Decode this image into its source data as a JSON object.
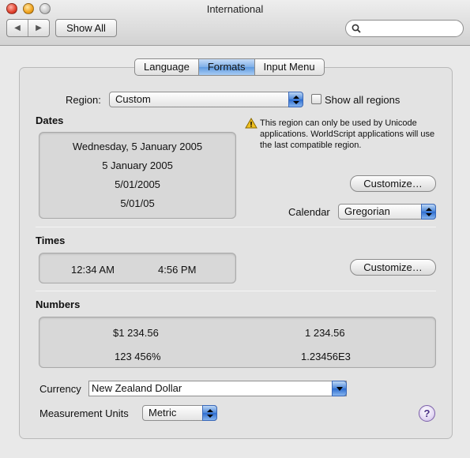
{
  "window": {
    "title": "International"
  },
  "toolbar": {
    "back_label": "◀",
    "forward_label": "▶",
    "show_all_label": "Show All",
    "search_placeholder": ""
  },
  "tabs": [
    {
      "label": "Language",
      "selected": false
    },
    {
      "label": "Formats",
      "selected": true
    },
    {
      "label": "Input Menu",
      "selected": false
    }
  ],
  "region": {
    "label": "Region:",
    "value": "Custom",
    "show_all_label": "Show all regions",
    "show_all_checked": false
  },
  "warning": {
    "text": "This region can only be used by Unicode applications. WorldScript applications will use the last compatible region."
  },
  "dates": {
    "heading": "Dates",
    "samples": [
      "Wednesday, 5 January 2005",
      "5 January 2005",
      "5/01/2005",
      "5/01/05"
    ],
    "customize_label": "Customize…",
    "calendar_label": "Calendar",
    "calendar_value": "Gregorian"
  },
  "times": {
    "heading": "Times",
    "samples": [
      "12:34 AM",
      "4:56 PM"
    ],
    "customize_label": "Customize…"
  },
  "numbers": {
    "heading": "Numbers",
    "samples": [
      "$1 234.56",
      "1 234.56",
      "123 456%",
      "1.23456E3"
    ]
  },
  "currency": {
    "label": "Currency",
    "value": "New Zealand Dollar"
  },
  "measurement": {
    "label": "Measurement Units",
    "value": "Metric"
  },
  "help": {
    "label": "?"
  },
  "colors": {
    "accent": "#5f9ae0",
    "warning": "#f0c020"
  }
}
